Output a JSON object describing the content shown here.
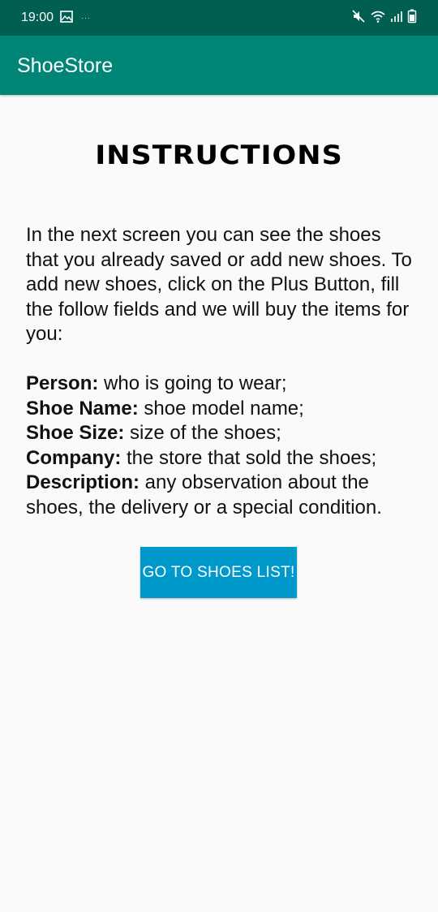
{
  "status_bar": {
    "time": "19:00",
    "dots": "···",
    "icons": [
      "image-icon",
      "mute-icon",
      "wifi-icon",
      "signal-icon",
      "battery-icon"
    ]
  },
  "app_bar": {
    "title": "ShoeStore"
  },
  "main": {
    "heading": "INSTRUCTIONS",
    "intro": "In the next screen you can see the shoes that you already saved or add new shoes. To add new shoes, click on the Plus Button, fill the follow fields and we will buy the items for you:",
    "fields": [
      {
        "label": "Person:",
        "desc": " who is going to wear;"
      },
      {
        "label": "Shoe Name:",
        "desc": " shoe model name;"
      },
      {
        "label": "Shoe Size:",
        "desc": " size of the shoes;"
      },
      {
        "label": "Company:",
        "desc": " the store that sold the shoes;"
      },
      {
        "label": "Description:",
        "desc": " any observation about the shoes, the delivery or a special condition."
      }
    ],
    "button_label": "GO TO SHOES LIST!"
  },
  "colors": {
    "status_bar": "#005f50",
    "app_bar": "#008577",
    "button": "#0099cc",
    "background": "#fafafa"
  }
}
